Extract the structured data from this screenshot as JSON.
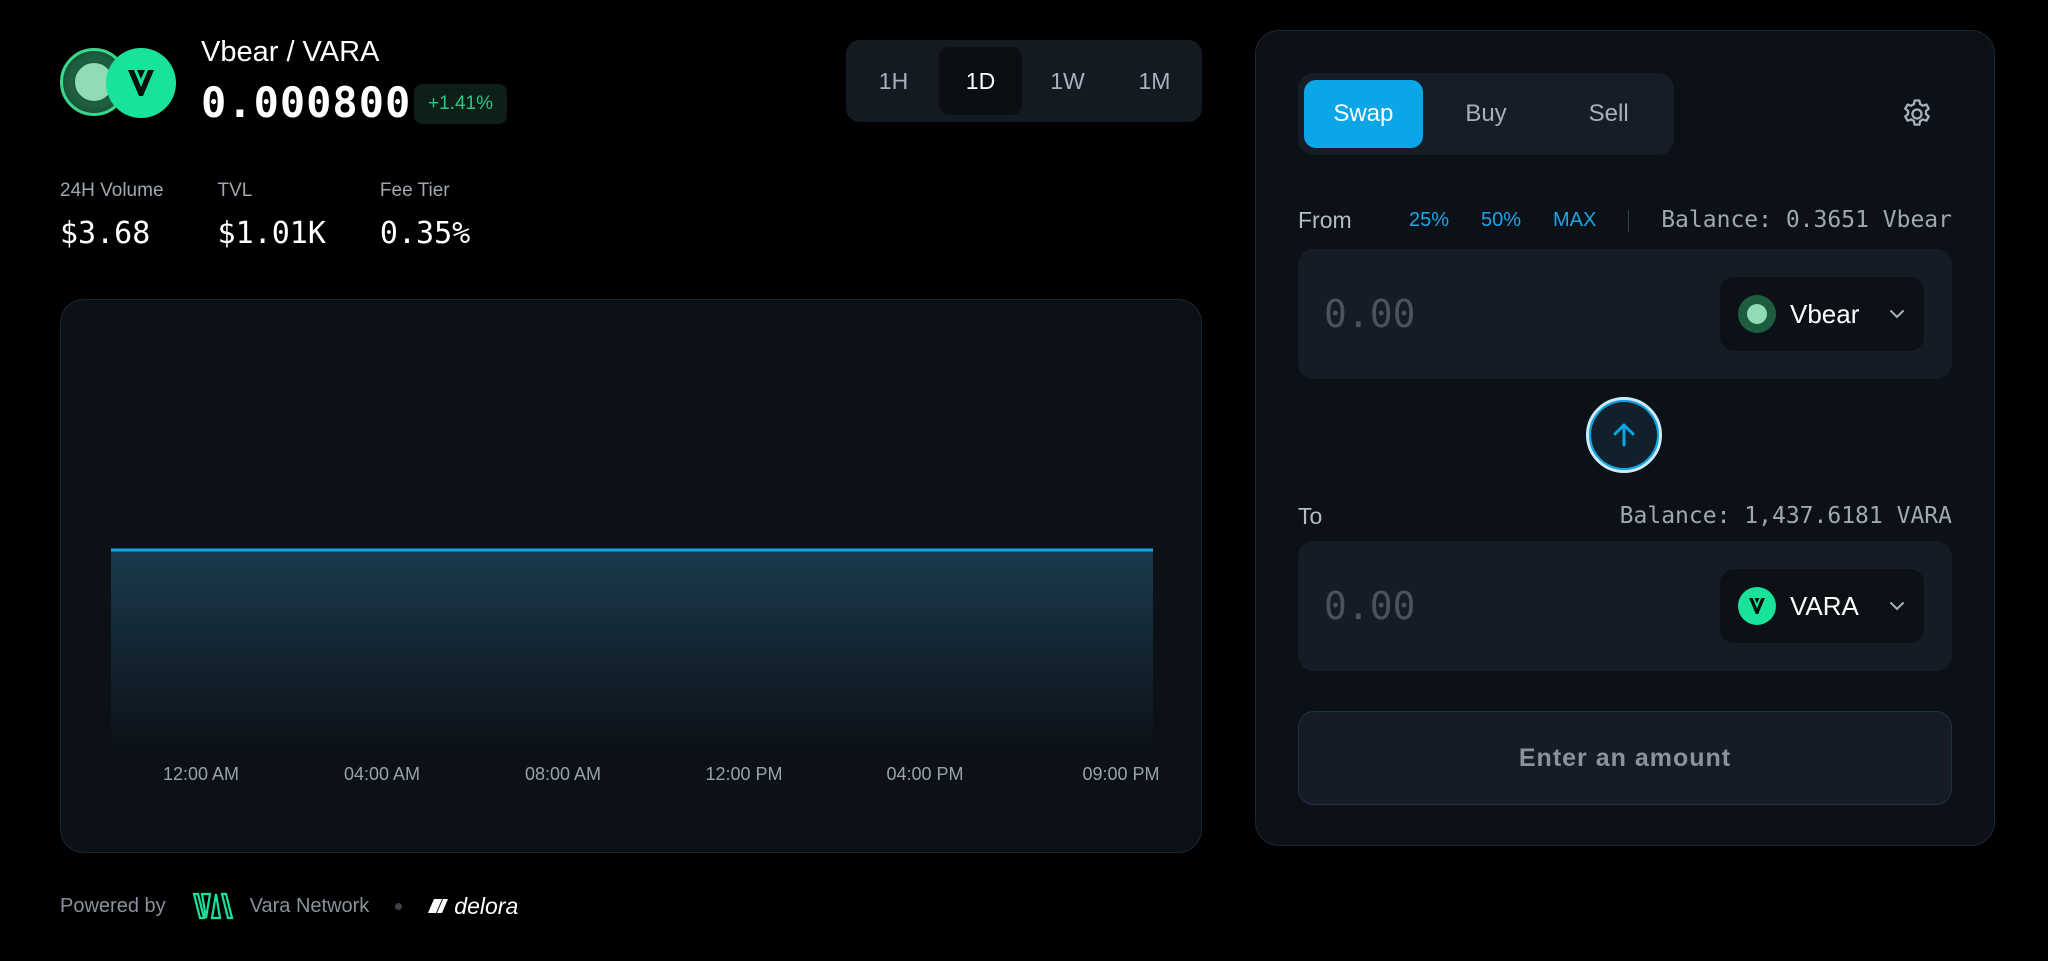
{
  "pair": {
    "name": "Vbear / VARA",
    "price": "0.000800",
    "change": "+1.41%"
  },
  "timeframes": {
    "items": [
      "1H",
      "1D",
      "1W",
      "1M"
    ],
    "active": "1D"
  },
  "stats": [
    {
      "label": "24H Volume",
      "value": "$3.68"
    },
    {
      "label": "TVL",
      "value": "$1.01K"
    },
    {
      "label": "Fee Tier",
      "value": "0.35%"
    }
  ],
  "chart_data": {
    "type": "area",
    "x": [
      "12:00 AM",
      "04:00 AM",
      "08:00 AM",
      "12:00 PM",
      "04:00 PM",
      "09:00 PM"
    ],
    "series": [
      {
        "values": [
          0.0008,
          0.0008,
          0.0008,
          0.0008,
          0.0008,
          0.0008
        ]
      }
    ],
    "grid": false,
    "colors": {
      "line": "#0aa6e8",
      "fill_top": "#1a3a4c",
      "fill_bottom": "#0c1118"
    }
  },
  "footer": {
    "powered_by": "Powered by",
    "network_name": "Vara Network",
    "partner": "delora"
  },
  "swap": {
    "tabs": [
      "Swap",
      "Buy",
      "Sell"
    ],
    "active_tab": "Swap",
    "from": {
      "label": "From",
      "percent_buttons": [
        "25%",
        "50%",
        "MAX"
      ],
      "balance": "Balance: 0.3651 Vbear",
      "placeholder": "0.00",
      "token": "Vbear"
    },
    "to": {
      "label": "To",
      "balance": "Balance: 1,437.6181 VARA",
      "placeholder": "0.00",
      "token": "VARA"
    },
    "submit_label": "Enter an amount"
  },
  "colors": {
    "accent": "#0aa6e8",
    "positive": "#22c98a",
    "vara_green": "#19e39a"
  },
  "icons": {
    "settings": "gear-icon",
    "flip": "arrow-up-icon",
    "dropdown": "chevron-down-icon"
  }
}
